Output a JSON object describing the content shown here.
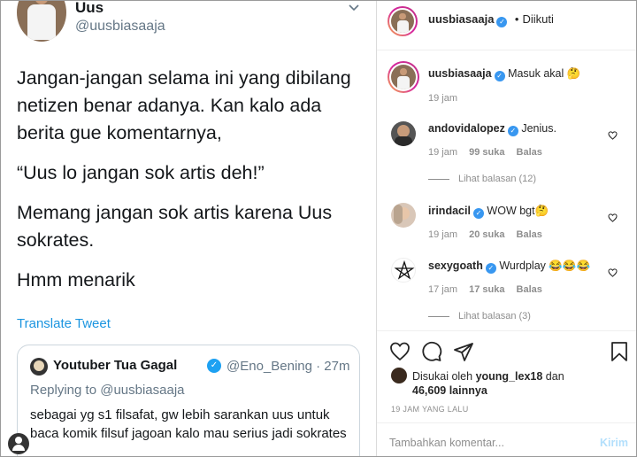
{
  "tweet": {
    "name": "Uus",
    "handle": "@uusbiasaaja",
    "paragraphs": [
      "Jangan-jangan selama ini yang dibilang netizen benar adanya. Kan kalo ada berita gue komentarnya,",
      "“Uus lo jangan sok artis deh!”",
      "Memang jangan sok artis karena Uus sokrates.",
      "Hmm menarik"
    ],
    "translate_label": "Translate Tweet",
    "quote": {
      "name": "Youtuber Tua Gagal",
      "meta": "@Eno_Bening · 27m",
      "replying_prefix": "Replying to ",
      "replying_handle": "@uusbiasaaja",
      "text": "sebagai yg s1 filsafat, gw lebih sarankan uus untuk baca komik filsuf jagoan kalo mau serius jadi sokrates"
    }
  },
  "instagram": {
    "header": {
      "username": "uusbiasaaja",
      "separator": "•",
      "follow_status": "Diikuti"
    },
    "caption": {
      "username": "uusbiasaaja",
      "text": "Masuk akal 🤔",
      "time": "19 jam"
    },
    "comments": [
      {
        "username": "andovidalopez",
        "text": "Jenius.",
        "time": "19 jam",
        "likes": "99 suka",
        "reply": "Balas",
        "view_replies": "Lihat balasan (12)"
      },
      {
        "username": "irindacil",
        "text": "WOW bgt🤔",
        "time": "19 jam",
        "likes": "20 suka",
        "reply": "Balas",
        "view_replies": ""
      },
      {
        "username": "sexygoath",
        "text": "Wurdplay 😂😂😂",
        "time": "17 jam",
        "likes": "17 suka",
        "reply": "Balas",
        "view_replies": "Lihat balasan (3)"
      }
    ],
    "likes": {
      "prefix": "Disukai oleh",
      "user": "young_lex18",
      "connector": "dan",
      "count": "46,609 lainnya"
    },
    "timestamp": "19 JAM YANG LALU",
    "comment_placeholder": "Tambahkan komentar...",
    "post_label": "Kirim",
    "colors": {
      "verified": "#3897f0",
      "link": "#1b95e0",
      "post_disabled": "#b2dffc"
    },
    "icons": [
      "heart-icon",
      "comment-icon",
      "share-icon",
      "bookmark-icon"
    ]
  }
}
